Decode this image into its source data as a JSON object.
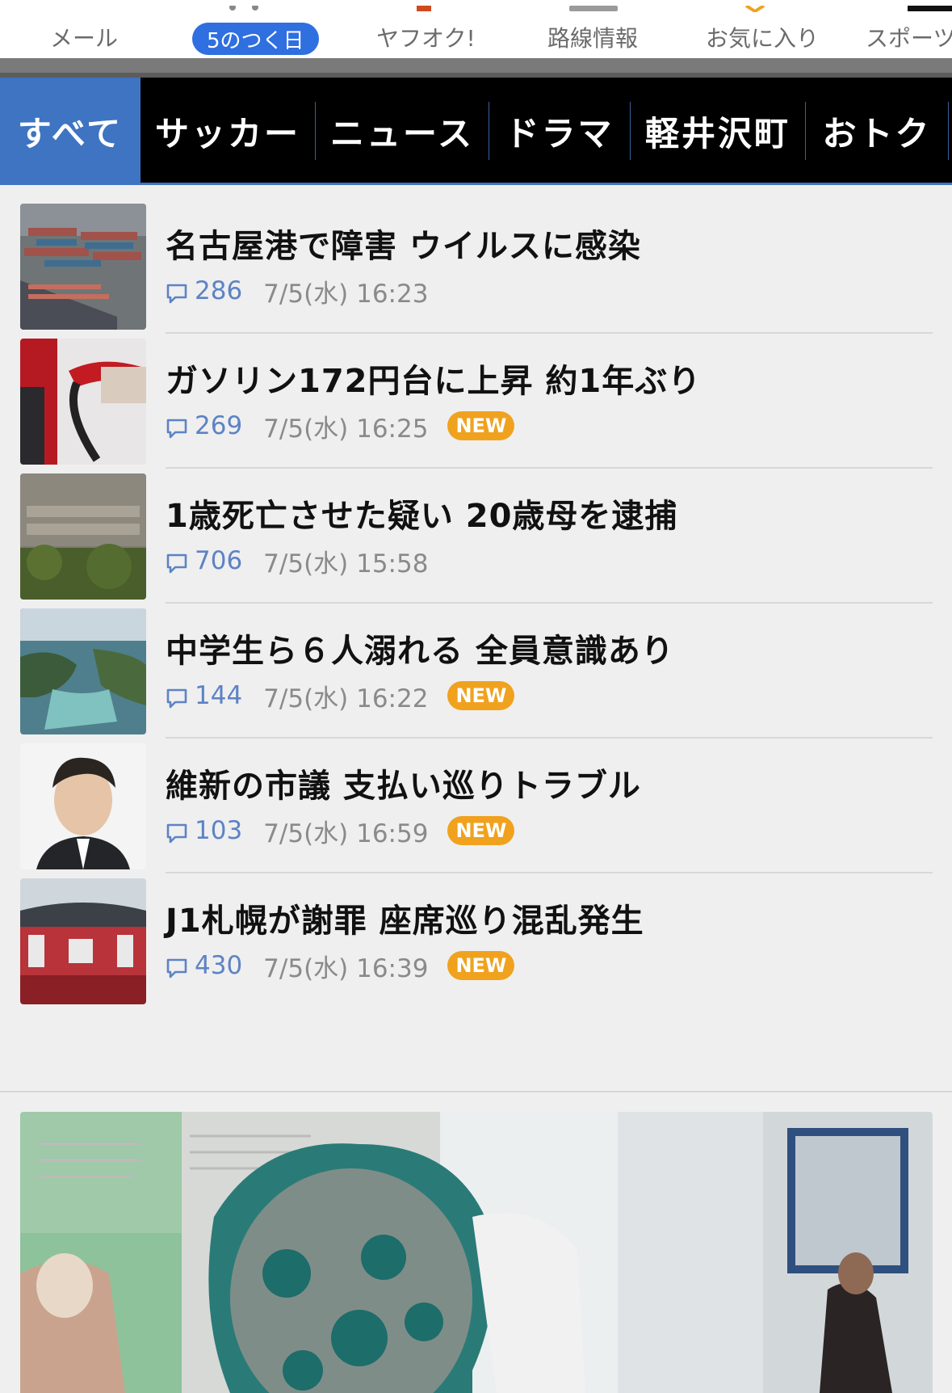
{
  "services": [
    {
      "label": "メール"
    },
    {
      "label": "5のつく日",
      "active": true
    },
    {
      "label": "ヤフオク!"
    },
    {
      "label": "路線情報"
    },
    {
      "label": "お気に入り"
    },
    {
      "label": "スポーツ"
    }
  ],
  "tabs": [
    {
      "label": "すべて",
      "active": true
    },
    {
      "label": "サッカー"
    },
    {
      "label": "ニュース"
    },
    {
      "label": "ドラマ"
    },
    {
      "label": "軽井沢町"
    },
    {
      "label": "おトク"
    }
  ],
  "articles": [
    {
      "title": "名古屋港で障害 ウイルスに感染",
      "comments": "286",
      "date": "7/5(水) 16:23",
      "badge": ""
    },
    {
      "title": "ガソリン172円台に上昇 約1年ぶり",
      "comments": "269",
      "date": "7/5(水) 16:25",
      "badge": "NEW"
    },
    {
      "title": "1歳死亡させた疑い 20歳母を逮捕",
      "comments": "706",
      "date": "7/5(水) 15:58",
      "badge": ""
    },
    {
      "title": "中学生ら６人溺れる 全員意識あり",
      "comments": "144",
      "date": "7/5(水) 16:22",
      "badge": "NEW"
    },
    {
      "title": "維新の市議 支払い巡りトラブル",
      "comments": "103",
      "date": "7/5(水) 16:59",
      "badge": "NEW"
    },
    {
      "title": "J1札幌が謝罪 座席巡り混乱発生",
      "comments": "430",
      "date": "7/5(水) 16:39",
      "badge": "NEW"
    }
  ],
  "colors": {
    "accent": "#3e74c2",
    "badge": "#f0a21e",
    "comment_count": "#5d83c4"
  }
}
